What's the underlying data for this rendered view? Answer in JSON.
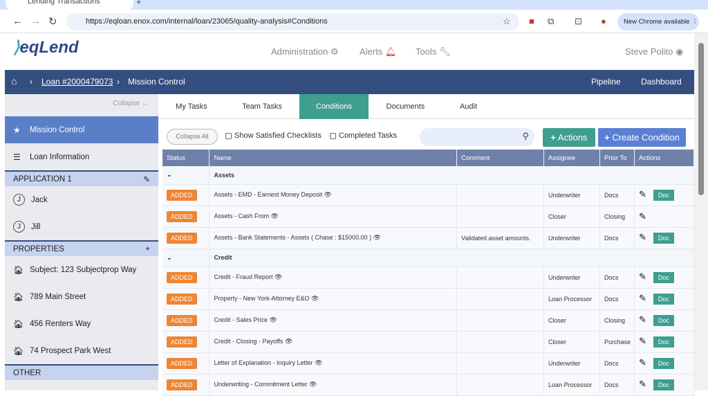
{
  "browser": {
    "tab_title": "Lending Transactions",
    "url": "https://eqloan.enox.com/internal/loan/23065/quality-analysis#Conditions",
    "new_chrome": "New Chrome available"
  },
  "header": {
    "logo": "eqLend",
    "nav": [
      "Administration",
      "Alerts",
      "Tools"
    ],
    "user": "Steve Polito"
  },
  "breadcrumb": {
    "loan": "Loan #2000479073",
    "current": "Mission Control",
    "pipeline": "Pipeline",
    "dashboard": "Dashboard"
  },
  "sidebar": {
    "collapse": "Collapse",
    "mission": "Mission Control",
    "loan_info": "Loan Information",
    "application": "APPLICATION 1",
    "borrowers": [
      {
        "initial": "J",
        "name": "Jack"
      },
      {
        "initial": "J",
        "name": "Jill"
      }
    ],
    "properties_label": "PROPERTIES",
    "properties": [
      "Subject: 123 Subjectprop Way",
      "789 Main Street",
      "456 Renters Way",
      "74 Prospect Park West"
    ],
    "other": "OTHER"
  },
  "tabs": [
    "My Tasks",
    "Team Tasks",
    "Conditions",
    "Documents",
    "Audit"
  ],
  "toolbar": {
    "collapse_all": "Collapse All",
    "show_satisfied": "Show Satisfied Checklists",
    "completed": "Completed Tasks",
    "actions": "Actions",
    "create": "Create Condition"
  },
  "table": {
    "headers": [
      "Status",
      "Name",
      "Comment",
      "Assignee",
      "Prior To",
      "Actions"
    ],
    "groups": [
      {
        "name": "Assets",
        "rows": [
          {
            "status": "ADDED",
            "name": "Assets - EMD - Earnest Money Deposit",
            "comment": "",
            "assignee": "Underwriter",
            "prior": "Docs",
            "doc": "Doc"
          },
          {
            "status": "ADDED",
            "name": "Assets - Cash From",
            "comment": "",
            "assignee": "Closer",
            "prior": "Closing",
            "doc": ""
          },
          {
            "status": "ADDED",
            "name": "Assets - Bank Statements - Assets ( Chase : $15000.00 )",
            "comment": "Validated asset amounts.",
            "assignee": "Underwriter",
            "prior": "Docs",
            "doc": "Doc"
          }
        ]
      },
      {
        "name": "Credit",
        "rows": [
          {
            "status": "ADDED",
            "name": "Credit - Fraud Report",
            "comment": "",
            "assignee": "Underwriter",
            "prior": "Docs",
            "doc": "Doc"
          },
          {
            "status": "ADDED",
            "name": "Property - New York-Attorney E&O",
            "comment": "",
            "assignee": "Loan Processor",
            "prior": "Docs",
            "doc": "Doc"
          },
          {
            "status": "ADDED",
            "name": "Credit - Sales Price",
            "comment": "",
            "assignee": "Closer",
            "prior": "Closing",
            "doc": "Doc"
          },
          {
            "status": "ADDED",
            "name": "Credit - Closing - Payoffs",
            "comment": "",
            "assignee": "Closer",
            "prior": "Purchase",
            "doc": "Doc"
          },
          {
            "status": "ADDED",
            "name": "Letter of Explanation - Inquiry Letter",
            "comment": "",
            "assignee": "Underwriter",
            "prior": "Docs",
            "doc": "Doc"
          },
          {
            "status": "ADDED",
            "name": "Underwriting - Commitment Letter",
            "comment": "",
            "assignee": "Loan Processor",
            "prior": "Docs",
            "doc": "Doc"
          }
        ]
      }
    ]
  }
}
